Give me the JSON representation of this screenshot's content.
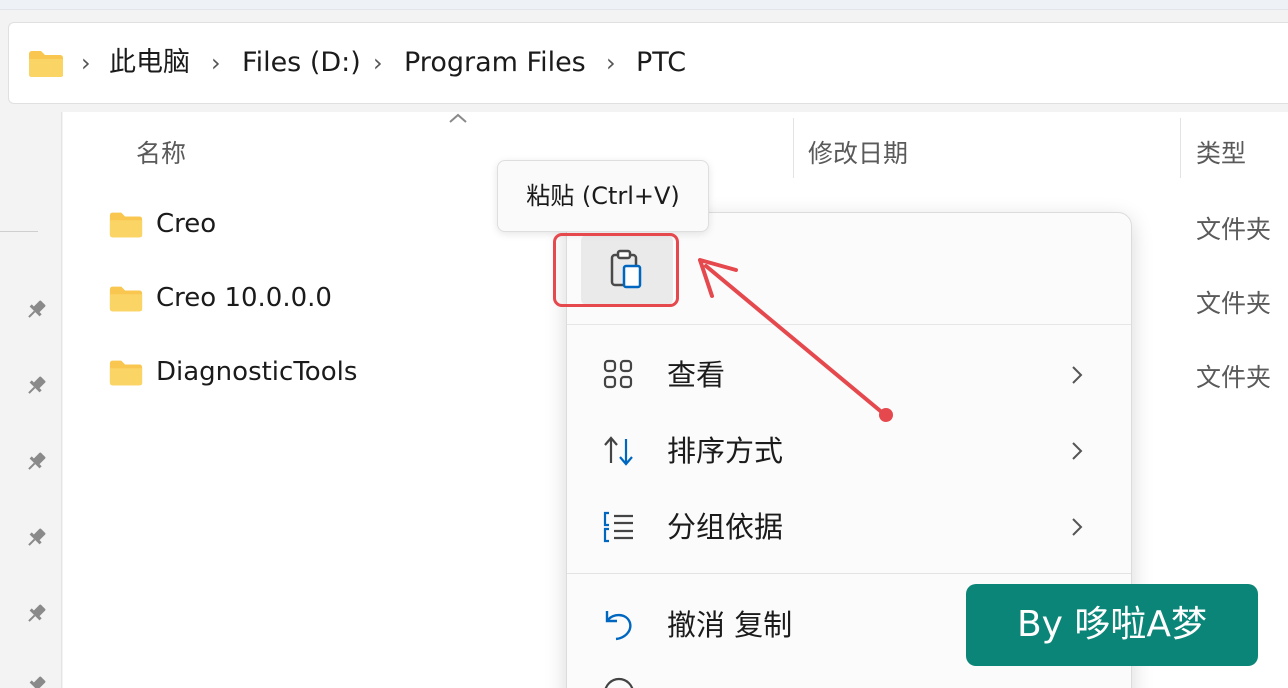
{
  "breadcrumb": {
    "items": [
      "此电脑",
      "Files (D:)",
      "Program Files",
      "PTC"
    ]
  },
  "columns": {
    "name": "名称",
    "modified": "修改日期",
    "type": "类型"
  },
  "files": [
    {
      "name": "Creo",
      "type": "文件夹"
    },
    {
      "name": "Creo 10.0.0.0",
      "type": "文件夹"
    },
    {
      "name": "DiagnosticTools",
      "type": "文件夹"
    }
  ],
  "context_menu": {
    "paste_tooltip": "粘贴 (Ctrl+V)",
    "items": [
      {
        "label": "查看",
        "icon": "grid-view-icon",
        "has_submenu": true
      },
      {
        "label": "排序方式",
        "icon": "sort-icon",
        "has_submenu": true
      },
      {
        "label": "分组依据",
        "icon": "group-list-icon",
        "has_submenu": true
      },
      {
        "label": "撤消 复制",
        "icon": "undo-icon",
        "has_submenu": false
      }
    ]
  },
  "watermark": "By 哆啦A梦",
  "colors": {
    "folder": "#f9c74f",
    "accent": "#0067c0",
    "annotation": "#e5484d",
    "watermark_bg": "#0b8577"
  }
}
